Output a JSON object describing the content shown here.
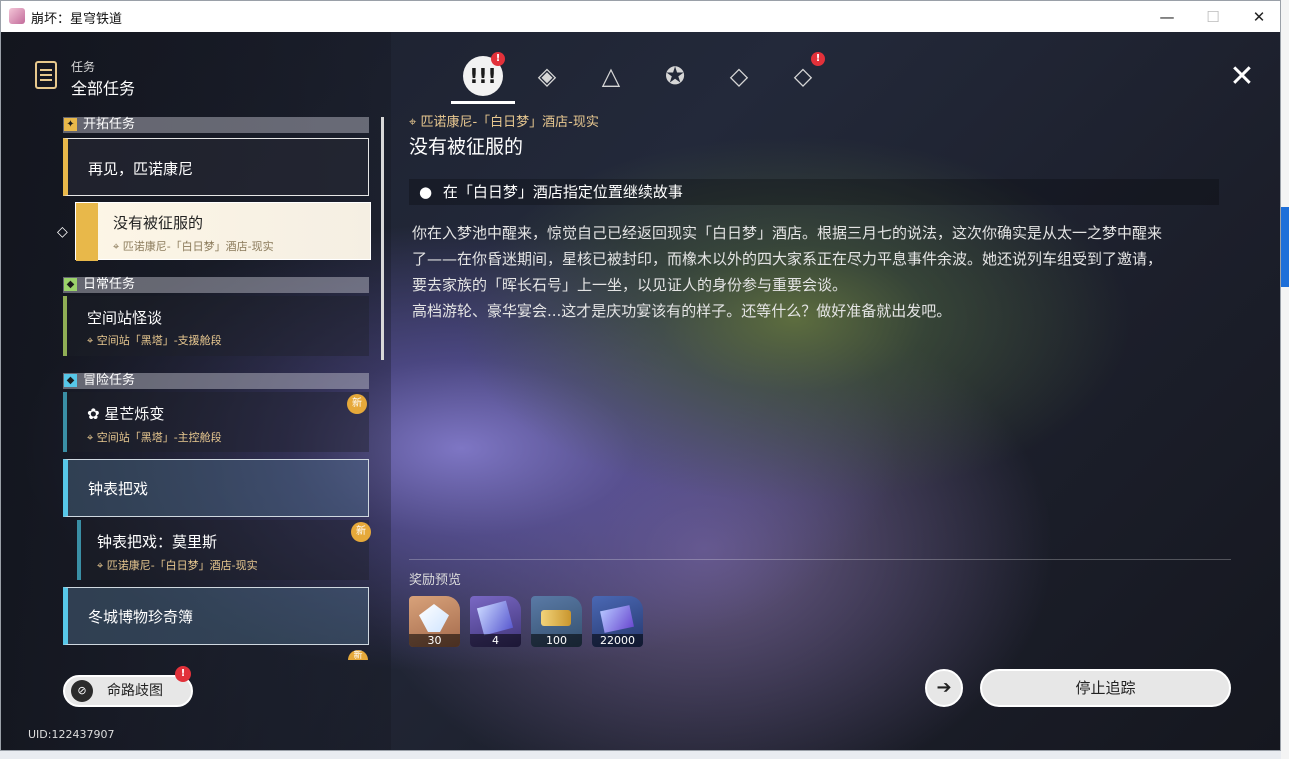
{
  "window": {
    "title": "崩坏：星穹铁道"
  },
  "header": {
    "subtitle": "任务",
    "title": "全部任务"
  },
  "tabs": [
    {
      "icon": "exclamation-tab-icon",
      "label": "!!!",
      "badge": "!"
    },
    {
      "icon": "trailblaze-tab-icon",
      "label": "◈"
    },
    {
      "icon": "companion-tab-icon",
      "label": "△"
    },
    {
      "icon": "adventure-tab-icon",
      "label": "✪"
    },
    {
      "icon": "daily-tab-icon",
      "label": "◇"
    },
    {
      "icon": "event-tab-icon",
      "label": "◇",
      "badge": "!"
    }
  ],
  "quest_list": {
    "section_trailblaze": "开拓任务",
    "trail_item_1": {
      "title": "再见，匹诺康尼"
    },
    "trail_item_2": {
      "title": "没有被征服的",
      "location": "匹诺康尼-「白日梦」酒店-现实"
    },
    "section_daily": "日常任务",
    "daily_item_1": {
      "title": "空间站怪谈",
      "location": "空间站「黑塔」-支援舱段"
    },
    "section_adventure": "冒险任务",
    "adv_item_1": {
      "title": "星芒烁变",
      "location": "空间站「黑塔」-主控舱段",
      "badge": "新"
    },
    "adv_group_1": {
      "title": "钟表把戏"
    },
    "adv_sub_1": {
      "title": "钟表把戏：莫里斯",
      "location": "匹诺康尼-「白日梦」酒店-现实",
      "badge": "新"
    },
    "adv_group_2": {
      "title": "冬城博物珍奇簿"
    },
    "adv_next_badge": "新"
  },
  "detail": {
    "location": "匹诺康尼-「白日梦」酒店-现实",
    "title": "没有被征服的",
    "objective": "在「白日梦」酒店指定位置继续故事",
    "desc_lines": [
      "你在入梦池中醒来，惊觉自己已经返回现实「白日梦」酒店。根据三月七的说法，这次你确实是从太一之梦中醒来",
      "了——在你昏迷期间，星核已被封印，而橡木以外的四大家系正在尽力平息事件余波。她还说列车组受到了邀请，",
      "要去家族的「晖长石号」上一坐，以见证人的身份参与重要会谈。",
      "高档游轮、豪华宴会...这才是庆功宴该有的样子。还等什么？做好准备就出发吧。"
    ],
    "rewards_label": "奖励预览",
    "rewards": [
      {
        "name": "crystal-reward",
        "qty": "30"
      },
      {
        "name": "book-reward",
        "qty": "4"
      },
      {
        "name": "ticket-reward",
        "qty": "100"
      },
      {
        "name": "credit-reward",
        "qty": "22000"
      }
    ]
  },
  "footer": {
    "path_button": "命路歧图",
    "path_badge": "!",
    "stop_tracking": "停止追踪",
    "uid": "UID:122437907"
  }
}
